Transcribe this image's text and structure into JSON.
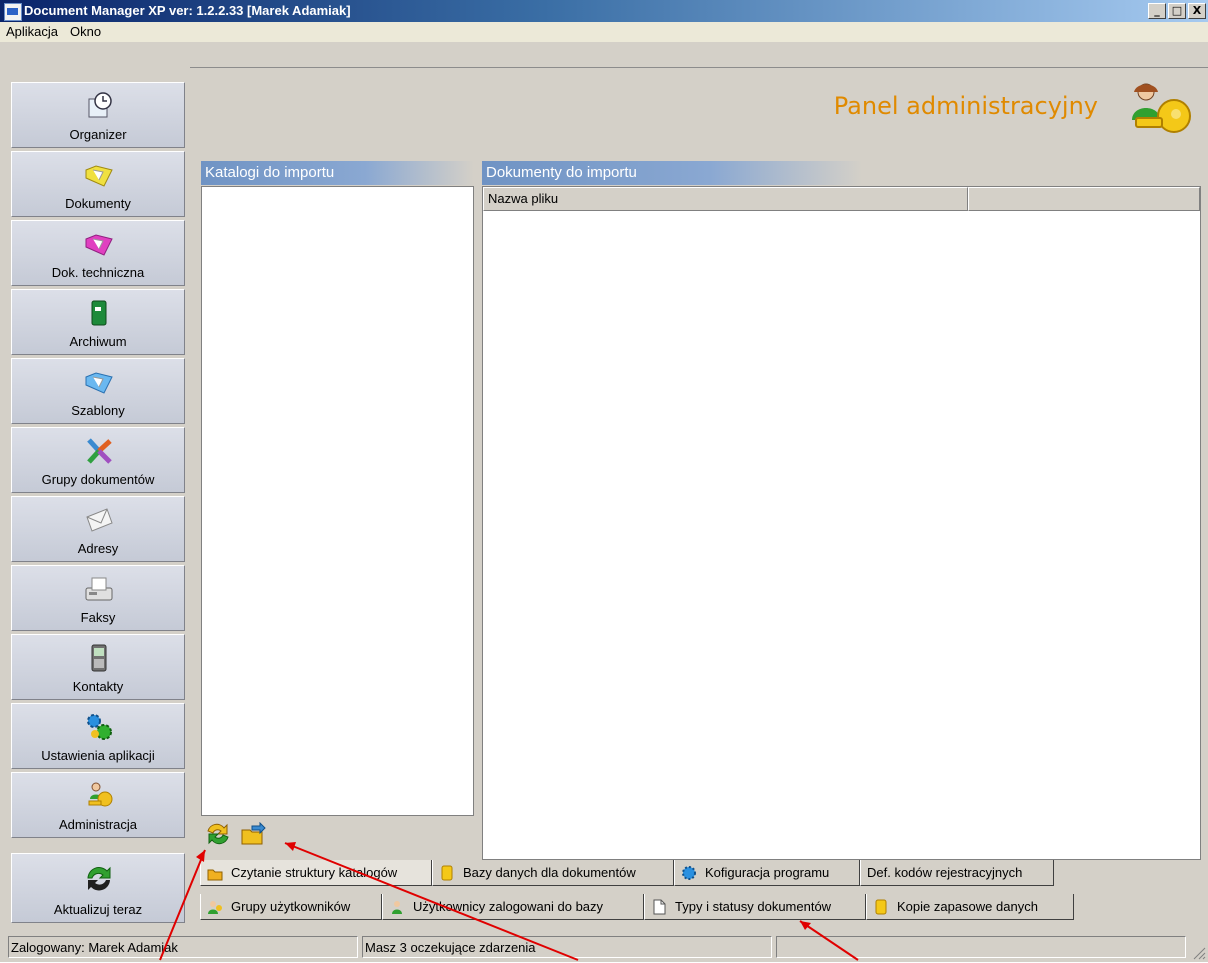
{
  "window": {
    "title": "Document Manager XP ver: 1.2.2.33  [Marek Adamiak]",
    "buttons": [
      "_",
      "□",
      "X"
    ]
  },
  "menu": [
    "Aplikacja",
    "Okno"
  ],
  "sidebar": {
    "items": [
      {
        "label": "Organizer",
        "icon": "organizer-icon"
      },
      {
        "label": "Dokumenty",
        "icon": "documents-folder-icon"
      },
      {
        "label": "Dok. techniczna",
        "icon": "technical-docs-folder-icon"
      },
      {
        "label": "Archiwum",
        "icon": "archive-book-icon"
      },
      {
        "label": "Szablony",
        "icon": "templates-folder-icon"
      },
      {
        "label": "Grupy dokumentów",
        "icon": "document-groups-icon"
      },
      {
        "label": "Adresy",
        "icon": "envelope-icon"
      },
      {
        "label": "Faksy",
        "icon": "fax-icon"
      },
      {
        "label": "Kontakty",
        "icon": "phone-icon"
      },
      {
        "label": "Ustawienia aplikacji",
        "icon": "gears-icon"
      },
      {
        "label": "Administracja",
        "icon": "admin-key-icon"
      }
    ],
    "update": {
      "label": "Aktualizuj teraz",
      "icon": "update-arrows-icon"
    }
  },
  "header": {
    "title": "Panel administracyjny",
    "icon": "admin-key-icon"
  },
  "panels": {
    "catalogs_title": "Katalogi do importu",
    "documents_title": "Dokumenty do importu",
    "columns": [
      "Nazwa pliku",
      ""
    ]
  },
  "toolbar": {
    "icons": [
      "refresh-icon",
      "import-folder-icon"
    ]
  },
  "tabs": {
    "row1": [
      {
        "label": "Czytanie struktury katalogów",
        "icon": "folders-icon",
        "active": true
      },
      {
        "label": "Bazy danych dla dokumentów",
        "icon": "database-icon"
      },
      {
        "label": "Kofiguracja programu",
        "icon": "gear-icon"
      },
      {
        "label": "Def. kodów rejestracyjnych",
        "icon": ""
      }
    ],
    "row2": [
      {
        "label": "Grupy użytkowników",
        "icon": "user-group-icon"
      },
      {
        "label": "Użytkownicy zalogowani do bazy",
        "icon": "users-icon"
      },
      {
        "label": "Typy i statusy dokumentów",
        "icon": "document-icon"
      },
      {
        "label": "Kopie zapasowe danych",
        "icon": "database-icon"
      }
    ]
  },
  "status": {
    "user": "Zalogowany: Marek Adamiak",
    "events": "Masz 3 oczekujące zdarzenia",
    "empty": ""
  },
  "colors": {
    "accent_orange": "#e08a00",
    "panel_title_blue": "#6f93c4",
    "annotation_red": "#e00000"
  }
}
